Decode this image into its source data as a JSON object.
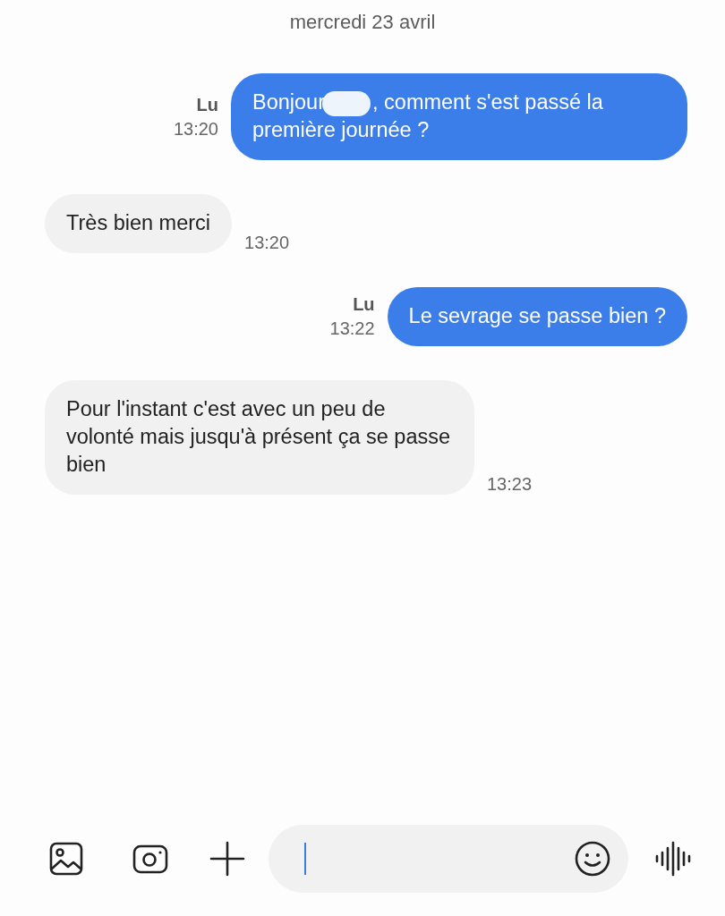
{
  "date_header": "mercredi 23 avril",
  "messages": [
    {
      "kind": "sent",
      "parts": [
        {
          "kind": "text",
          "text": "Bonjour"
        },
        {
          "kind": "redaction"
        },
        {
          "kind": "text",
          "text": ", comment s'est passé la première journée ?"
        }
      ],
      "status": "Lu",
      "time": "13:20"
    },
    {
      "kind": "received",
      "parts": [
        {
          "kind": "text",
          "text": "Très bien merci"
        }
      ],
      "time": "13:20"
    },
    {
      "kind": "sent",
      "parts": [
        {
          "kind": "text",
          "text": "Le sevrage se passe bien ?"
        }
      ],
      "status": "Lu",
      "time": "13:22"
    },
    {
      "kind": "received",
      "parts": [
        {
          "kind": "text",
          "text": "Pour l'instant c'est avec un peu de volonté mais jusqu'à présent ça se passe bien"
        }
      ],
      "time": "13:23"
    }
  ],
  "composer": {
    "focused": true
  }
}
